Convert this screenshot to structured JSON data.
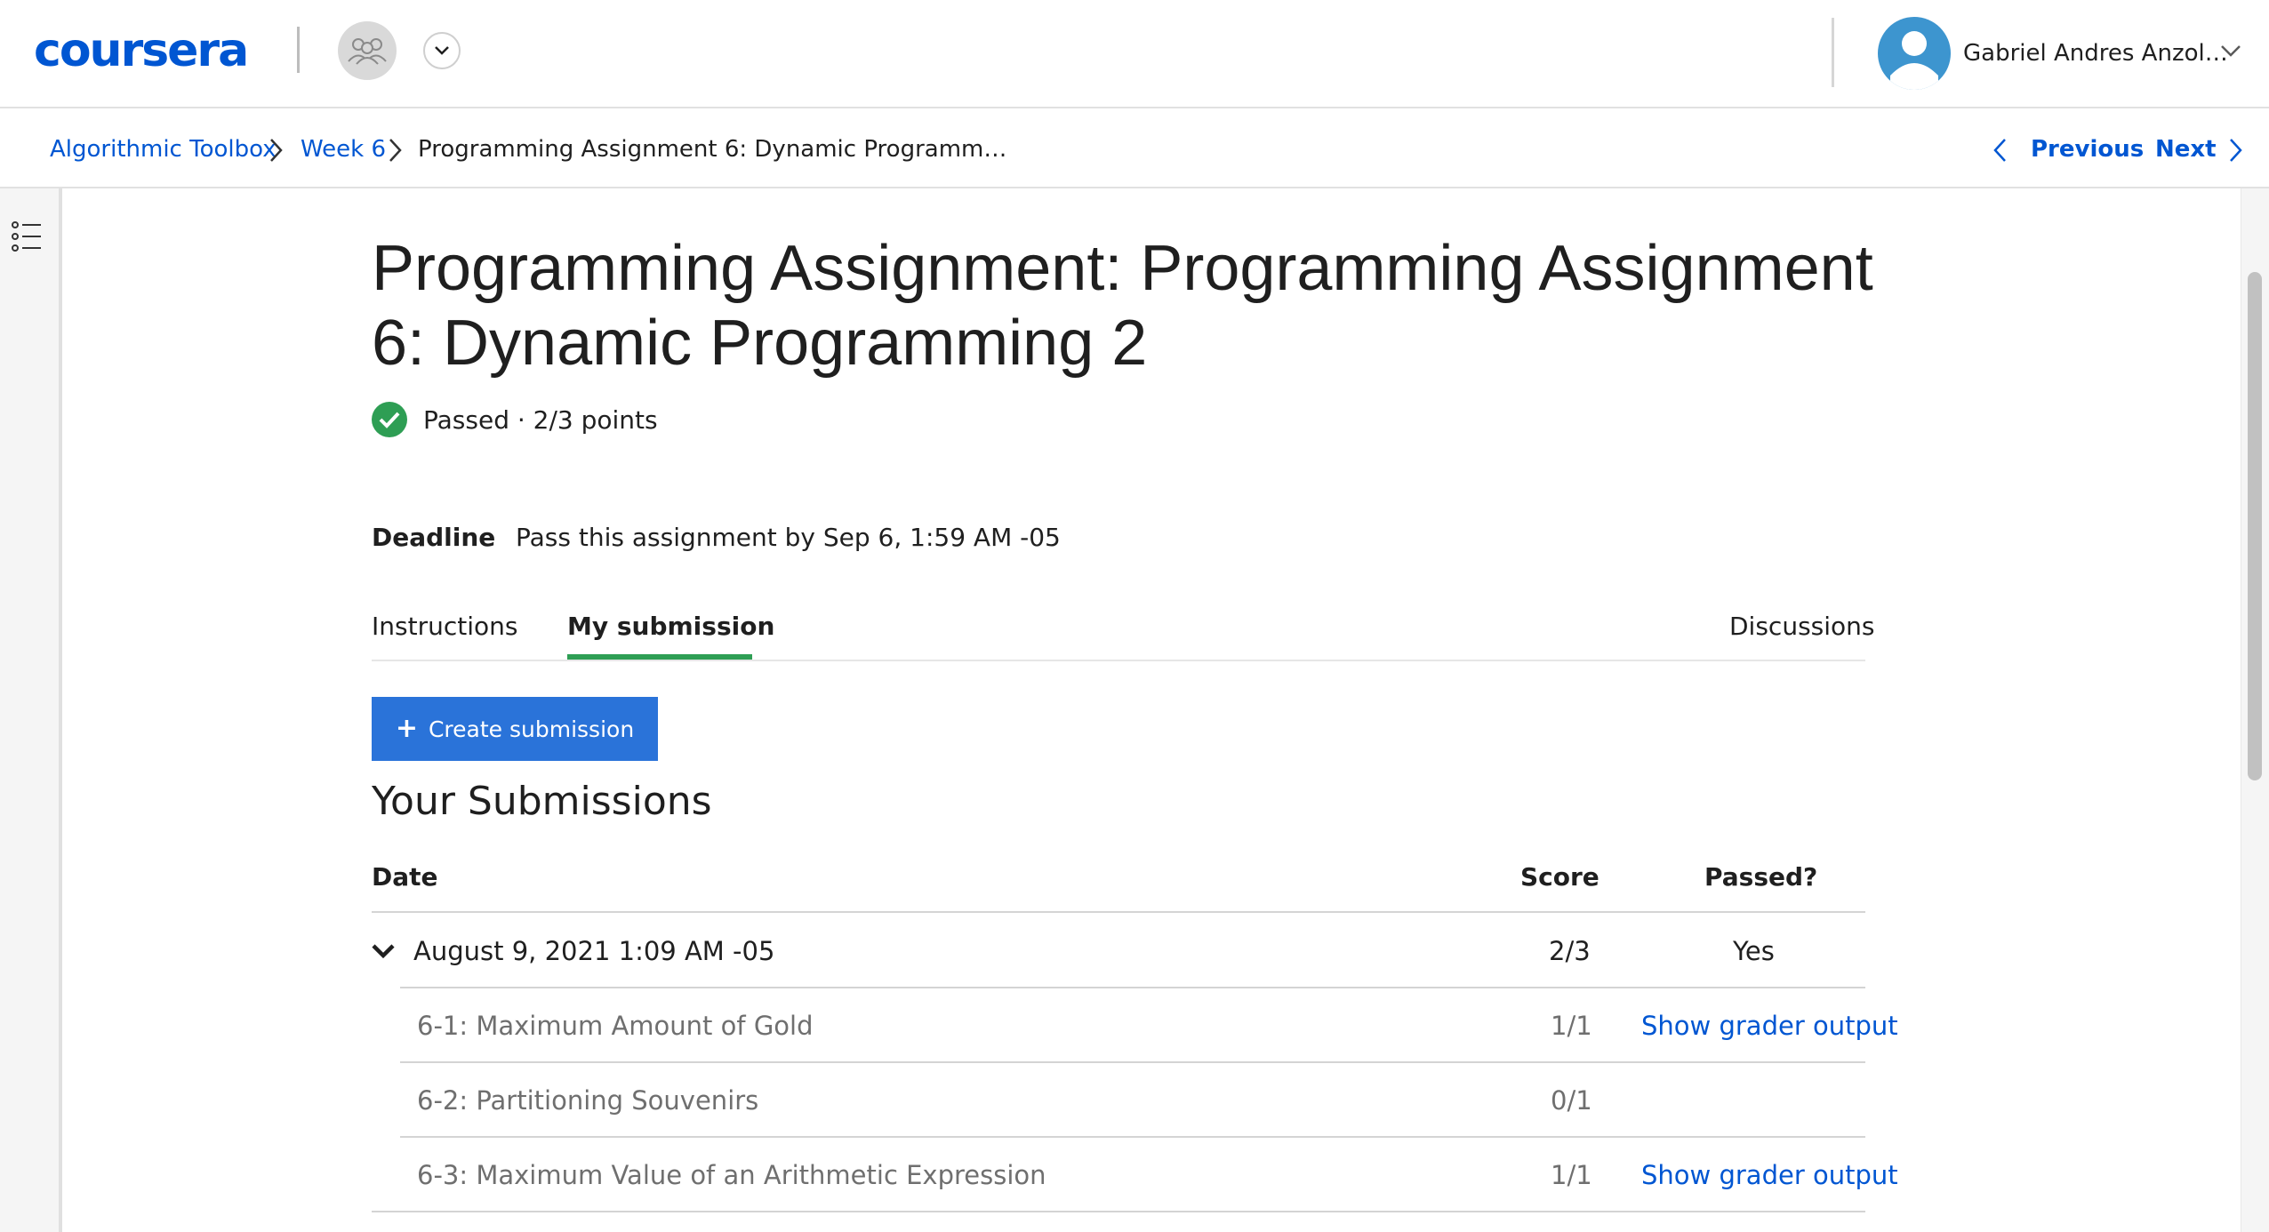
{
  "header": {
    "logo": "coursera",
    "user_name": "Gabriel Andres Anzol…"
  },
  "breadcrumb": {
    "course": "Algorithmic Toolbox",
    "week": "Week 6",
    "current": "Programming Assignment 6: Dynamic Programm…",
    "previous_label": "Previous",
    "next_label": "Next"
  },
  "assignment": {
    "title": "Programming Assignment: Programming Assignment 6: Dynamic Programming 2",
    "status": "Passed · 2/3 points",
    "deadline_label": "Deadline",
    "deadline_text": "Pass this assignment by Sep 6, 1:59 AM -05"
  },
  "tabs": [
    {
      "label": "Instructions"
    },
    {
      "label": "My submission"
    },
    {
      "label": "Discussions"
    }
  ],
  "create_button_label": "Create submission",
  "submissions": {
    "title": "Your Submissions",
    "headers": {
      "date": "Date",
      "score": "Score",
      "passed": "Passed?"
    },
    "rows": [
      {
        "date": "August 9, 2021 1:09 AM -05",
        "score": "2/3",
        "passed": "Yes",
        "parts": [
          {
            "name": "6-1: Maximum Amount of Gold",
            "score": "1/1",
            "action": "Show grader output"
          },
          {
            "name": "6-2: Partitioning Souvenirs",
            "score": "0/1",
            "action": ""
          },
          {
            "name": "6-3: Maximum Value of an Arithmetic Expression",
            "score": "1/1",
            "action": "Show grader output"
          }
        ]
      }
    ]
  },
  "colors": {
    "brand": "#0056d2",
    "success": "#2e9e54",
    "button": "#2a73d9"
  },
  "icons": [
    "group-icon",
    "chevron-down-icon",
    "user-avatar-icon",
    "chevron-right-icon",
    "chevron-left-icon",
    "outline-list-icon",
    "check-circle-icon",
    "plus-icon"
  ]
}
